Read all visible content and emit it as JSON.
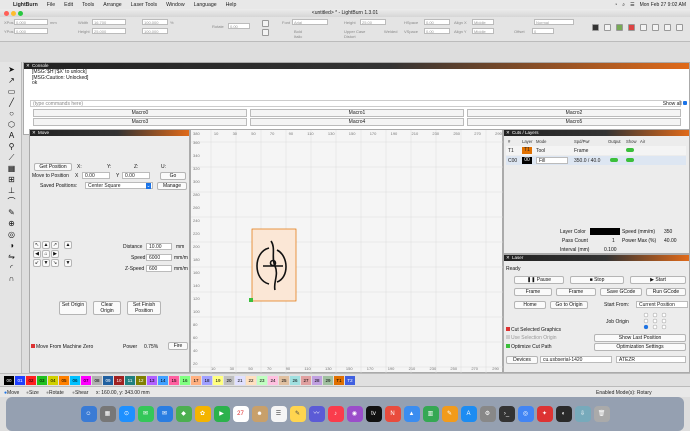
{
  "menubar": {
    "items": [
      "LightBurn",
      "File",
      "Edit",
      "Tools",
      "Arrange",
      "Laser Tools",
      "Window",
      "Language",
      "Help"
    ],
    "clock": "Mon Feb 27  9:02 AM"
  },
  "window": {
    "title": "<untitled> * - LightBurn 1.3.01"
  },
  "toolbar": {
    "xpos_label": "XPos",
    "xpos": "0.000",
    "ypos_label": "YPos",
    "ypos": "0.000",
    "unit": "mm",
    "width_label": "Width",
    "width": "16.700",
    "height_label": "Height",
    "height": "25.000",
    "pct_w": "100.000",
    "pct_h": "100.000",
    "pct_unit": "%",
    "rotate_label": "Rotate",
    "rotate": "0.00",
    "font_label": "Font",
    "font": "Arial",
    "font_height_label": "Height",
    "font_height": "25.00",
    "hspace_label": "HSpace",
    "hspace": "0.00",
    "vspace_label": "VSpace",
    "vspace": "0.00",
    "alignx_label": "Align X",
    "alignx": "Middle",
    "aligny_label": "Align Y",
    "aligny": "Middle",
    "normal": "Normal",
    "offset_label": "Offset",
    "offset": "0",
    "bold": "Bold",
    "italic": "Italic",
    "upper": "Upper Case",
    "distort": "Distort",
    "welded": "Welded"
  },
  "console": {
    "title": "Console",
    "lines": [
      "[MSG:'$H'|'$X' to unlock]",
      "[MSG:Caution: Unlocked]",
      "ok"
    ],
    "placeholder": "(type commands here)",
    "show_all": "Show all",
    "macros": [
      "Macro0",
      "Macro1",
      "Macro2",
      "Macro3",
      "Macro4",
      "Macro5"
    ]
  },
  "move": {
    "title": "Move",
    "get_position": "Get Position",
    "x_label": "X:",
    "y_label": "Y:",
    "z_label": "Z:",
    "u_label": "U:",
    "move_to_position": "Move to Position",
    "mx_label": "X",
    "mx": "0.00",
    "my_label": "Y",
    "my": "0.00",
    "go": "Go",
    "saved_positions_label": "Saved Positions:",
    "saved_position": "Center Square",
    "manage": "Manage",
    "distance_label": "Distance",
    "distance": "10.00",
    "distance_unit": "mm",
    "speed_label": "Speed",
    "speed": "6000",
    "speed_unit": "mm/m",
    "zspeed_label": "Z-Speed",
    "zspeed": "600",
    "zspeed_unit": "mm/m",
    "set_origin": "Set Origin",
    "clear_origin": "Clear Origin",
    "set_finish": "Set Finish Position",
    "move_from_zero": "Move From Machine Zero",
    "power_label": "Power",
    "power": "0.75%",
    "fire": "Fire"
  },
  "canvas": {
    "top_ticks": [
      "380",
      "10",
      "30",
      "50",
      "70",
      "90",
      "110",
      "130",
      "150",
      "170",
      "190",
      "210",
      "230",
      "250",
      "270",
      "290"
    ],
    "bottom_ticks": [
      "10",
      "30",
      "50",
      "70",
      "90",
      "110",
      "130",
      "150",
      "170",
      "190",
      "210",
      "230",
      "250",
      "270",
      "290"
    ],
    "left_ticks": [
      "380",
      "360",
      "340",
      "320",
      "300",
      "280",
      "260",
      "240",
      "220",
      "200",
      "180",
      "160",
      "140",
      "120",
      "100",
      "80",
      "60",
      "40",
      "20"
    ]
  },
  "cuts": {
    "title": "Cuts / Layers",
    "headers": [
      "#",
      "Layer",
      "Mode",
      "Spd/Pwr",
      "Output",
      "Show",
      "Air"
    ],
    "rows": [
      {
        "num": "T1",
        "layer": "T1",
        "mode": "Tool",
        "spdpwr": "Frame",
        "color": "#e07000"
      },
      {
        "num": "C00",
        "layer": "00",
        "mode": "Fill",
        "spdpwr": "350.0 / 40.0",
        "color": "#000000"
      }
    ],
    "layer_color_label": "Layer Color",
    "speed_label": "Speed (mm/m)",
    "speed": "350",
    "pass_count_label": "Pass Count",
    "pass_count": "1",
    "power_max_label": "Power Max (%)",
    "power_max": "40.00",
    "interval_label": "Interval (mm)",
    "interval": "0.100"
  },
  "laser": {
    "title": "Laser",
    "status": "Ready",
    "pause": "Pause",
    "stop": "Stop",
    "start": "Start",
    "frame1": "Frame",
    "frame2": "Frame",
    "save_gcode": "Save GCode",
    "run_gcode": "Run GCode",
    "home": "Home",
    "go_to_origin": "Go to Origin",
    "start_from_label": "Start From:",
    "start_from": "Current Position",
    "job_origin_label": "Job Origin",
    "cut_selected": "Cut Selected Graphics",
    "use_selection_origin": "Use Selection Origin",
    "show_last": "Show Last Position",
    "optimize_cut": "Optimize Cut Path",
    "optimization_settings": "Optimization Settings",
    "devices": "Devices",
    "port": "cu.usbserial-1420",
    "device": "ATEZR"
  },
  "palette": {
    "swatches": [
      {
        "label": "00",
        "color": "#000000",
        "fg": "#ffffff"
      },
      {
        "label": "01",
        "color": "#1f3fff",
        "fg": "#ffffff"
      },
      {
        "label": "02",
        "color": "#ff2020",
        "fg": "#000"
      },
      {
        "label": "03",
        "color": "#20c020",
        "fg": "#000"
      },
      {
        "label": "04",
        "color": "#d0d000",
        "fg": "#000"
      },
      {
        "label": "05",
        "color": "#ff8000",
        "fg": "#000"
      },
      {
        "label": "06",
        "color": "#00c0ff",
        "fg": "#000"
      },
      {
        "label": "07",
        "color": "#ff00ff",
        "fg": "#000"
      },
      {
        "label": "08",
        "color": "#b0b0b0",
        "fg": "#000"
      },
      {
        "label": "09",
        "color": "#2060a0",
        "fg": "#ffffff"
      },
      {
        "label": "10",
        "color": "#a02020",
        "fg": "#ffffff"
      },
      {
        "label": "11",
        "color": "#208080",
        "fg": "#ffffff"
      },
      {
        "label": "12",
        "color": "#808000",
        "fg": "#ffffff"
      },
      {
        "label": "13",
        "color": "#b060ff",
        "fg": "#000"
      },
      {
        "label": "14",
        "color": "#40a0ff",
        "fg": "#000"
      },
      {
        "label": "15",
        "color": "#ff60a0",
        "fg": "#000"
      },
      {
        "label": "16",
        "color": "#80ff80",
        "fg": "#000"
      },
      {
        "label": "17",
        "color": "#ffb080",
        "fg": "#000"
      },
      {
        "label": "18",
        "color": "#a0a0ff",
        "fg": "#000"
      },
      {
        "label": "19",
        "color": "#ffff80",
        "fg": "#000"
      },
      {
        "label": "20",
        "color": "#c0c0c0",
        "fg": "#000"
      },
      {
        "label": "21",
        "color": "#e0e0ff",
        "fg": "#000"
      },
      {
        "label": "22",
        "color": "#ffe0c0",
        "fg": "#000"
      },
      {
        "label": "23",
        "color": "#c0ffc0",
        "fg": "#000"
      },
      {
        "label": "24",
        "color": "#ffc0e0",
        "fg": "#000"
      },
      {
        "label": "25",
        "color": "#e0c0a0",
        "fg": "#000"
      },
      {
        "label": "26",
        "color": "#a0e0e0",
        "fg": "#000"
      },
      {
        "label": "27",
        "color": "#e0a0a0",
        "fg": "#000"
      },
      {
        "label": "28",
        "color": "#c0a0e0",
        "fg": "#000"
      },
      {
        "label": "29",
        "color": "#a0c0a0",
        "fg": "#000"
      },
      {
        "label": "T1",
        "color": "#e07000",
        "fg": "#000"
      },
      {
        "label": "T2",
        "color": "#4060e0",
        "fg": "#ffffff"
      }
    ]
  },
  "status": {
    "move": "Move",
    "size": "Size",
    "rotate": "Rotate",
    "shear": "Shear",
    "coords": "x: 160.00, y: 343.00 mm",
    "mode": "Enabled Mode(s): Rotary"
  },
  "dock": {
    "calendar_day": "27"
  }
}
